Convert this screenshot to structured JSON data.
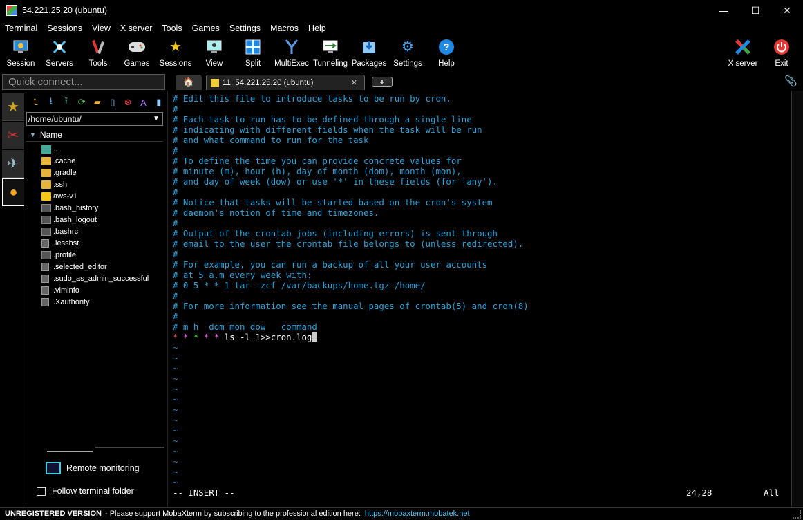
{
  "window": {
    "title": "54.221.25.20 (ubuntu)",
    "minimize": "—",
    "maximize": "☐",
    "close": "✕"
  },
  "menu": [
    "Terminal",
    "Sessions",
    "View",
    "X server",
    "Tools",
    "Games",
    "Settings",
    "Macros",
    "Help"
  ],
  "toolbar": {
    "session": "Session",
    "servers": "Servers",
    "tools": "Tools",
    "games": "Games",
    "sessions": "Sessions",
    "view": "View",
    "split": "Split",
    "multiexec": "MultiExec",
    "tunneling": "Tunneling",
    "packages": "Packages",
    "settings": "Settings",
    "help": "Help",
    "xserver": "X server",
    "exit": "Exit"
  },
  "quick_connect": {
    "placeholder": "Quick connect..."
  },
  "browser": {
    "path": "/home/ubuntu/",
    "column_name": "Name",
    "files": [
      "..",
      ".cache",
      ".gradle",
      ".ssh",
      "aws-v1",
      ".bash_history",
      ".bash_logout",
      ".bashrc",
      ".lesshst",
      ".profile",
      ".selected_editor",
      ".sudo_as_admin_successful",
      ".viminfo",
      ".Xauthority"
    ],
    "remote_monitoring": "Remote monitoring",
    "follow_terminal_folder": "Follow terminal folder"
  },
  "tabs": {
    "session_tab": "11. 54.221.25.20 (ubuntu)"
  },
  "terminal": {
    "lines": [
      "# Edit this file to introduce tasks to be run by cron.",
      "#",
      "# Each task to run has to be defined through a single line",
      "# indicating with different fields when the task will be run",
      "# and what command to run for the task",
      "#",
      "# To define the time you can provide concrete values for",
      "# minute (m), hour (h), day of month (dom), month (mon),",
      "# and day of week (dow) or use '*' in these fields (for 'any').",
      "#",
      "# Notice that tasks will be started based on the cron's system",
      "# daemon's notion of time and timezones.",
      "#",
      "# Output of the crontab jobs (including errors) is sent through",
      "# email to the user the crontab file belongs to (unless redirected).",
      "#",
      "# For example, you can run a backup of all your user accounts",
      "# at 5 a.m every week with:",
      "# 0 5 * * 1 tar -zcf /var/backups/home.tgz /home/",
      "#",
      "# For more information see the manual pages of crontab(5) and cron(8)",
      "#",
      "# m h  dom mon dow   command"
    ],
    "cron_stars": [
      "*",
      "*",
      "*",
      "*",
      "*"
    ],
    "star_colors": [
      "#ff5555",
      "#ff55ff",
      "#55ff55",
      "#ff55ff",
      "#ff55ff"
    ],
    "cron_command": "ls -l 1>>cron.log",
    "tilde": "~",
    "mode": "-- INSERT --",
    "position": "24,28",
    "scroll": "All"
  },
  "statusbar": {
    "unregistered": "UNREGISTERED VERSION",
    "message": "-  Please support MobaXterm by subscribing to the professional edition here:",
    "link": "https://mobaxterm.mobatek.net"
  }
}
